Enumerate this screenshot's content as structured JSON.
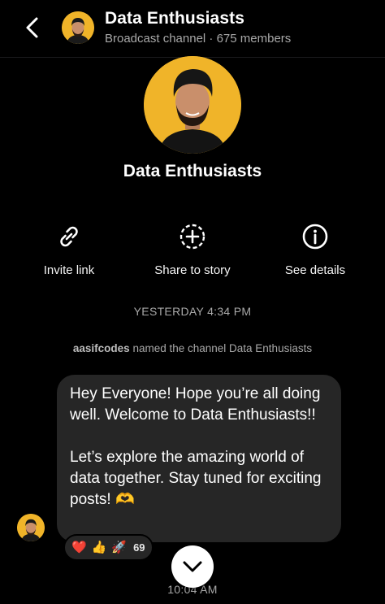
{
  "header": {
    "title": "Data Enthusiasts",
    "channel_type": "Broadcast channel",
    "separator": "·",
    "members": "675 members"
  },
  "profile": {
    "name": "Data Enthusiasts"
  },
  "actions": [
    {
      "label": "Invite link",
      "icon": "link-icon"
    },
    {
      "label": "Share to story",
      "icon": "add-to-story-icon"
    },
    {
      "label": "See details",
      "icon": "info-icon"
    }
  ],
  "timeline": {
    "timestamp_1": "YESTERDAY 4:34 PM",
    "system_user": "aasifcodes",
    "system_text": " named the channel Data Enthusiasts",
    "timestamp_2": "10:04 AM"
  },
  "message": {
    "paragraph_1": "Hey Everyone! Hope you’re all doing well. Welcome to Data Enthusiasts!!",
    "paragraph_2": "Let’s explore the amazing world of data together. Stay tuned for exciting posts! 🫶"
  },
  "reactions": {
    "emojis": [
      "❤️",
      "👍",
      "🚀"
    ],
    "count": "69"
  },
  "colors": {
    "background": "#000000",
    "bubble": "#262626",
    "avatar_bg": "#f0b429",
    "secondary_text": "#a8a8a8"
  }
}
